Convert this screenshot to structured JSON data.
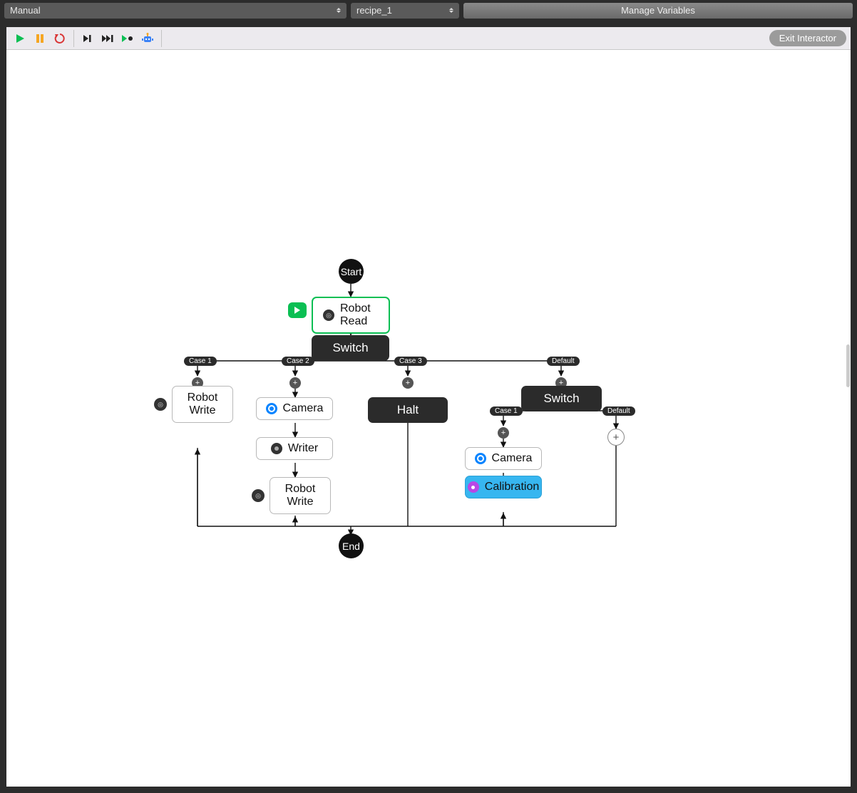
{
  "header": {
    "mode_select": "Manual",
    "recipe_select": "recipe_1",
    "manage_variables": "Manage Variables"
  },
  "toolbar": {
    "exit": "Exit Interactor"
  },
  "graph": {
    "start": "Start",
    "end": "End",
    "robot_read": "Robot Read",
    "switch1": "Switch",
    "case1": "Case 1",
    "case2": "Case 2",
    "case3": "Case 3",
    "default": "Default",
    "robot_write1": "Robot\nWrite",
    "camera1": "Camera",
    "writer": "Writer",
    "robot_write2": "Robot\nWrite",
    "halt": "Halt",
    "switch2": "Switch",
    "case1b": "Case 1",
    "defaultb": "Default",
    "camera2": "Camera",
    "calibration": "Calibration"
  }
}
